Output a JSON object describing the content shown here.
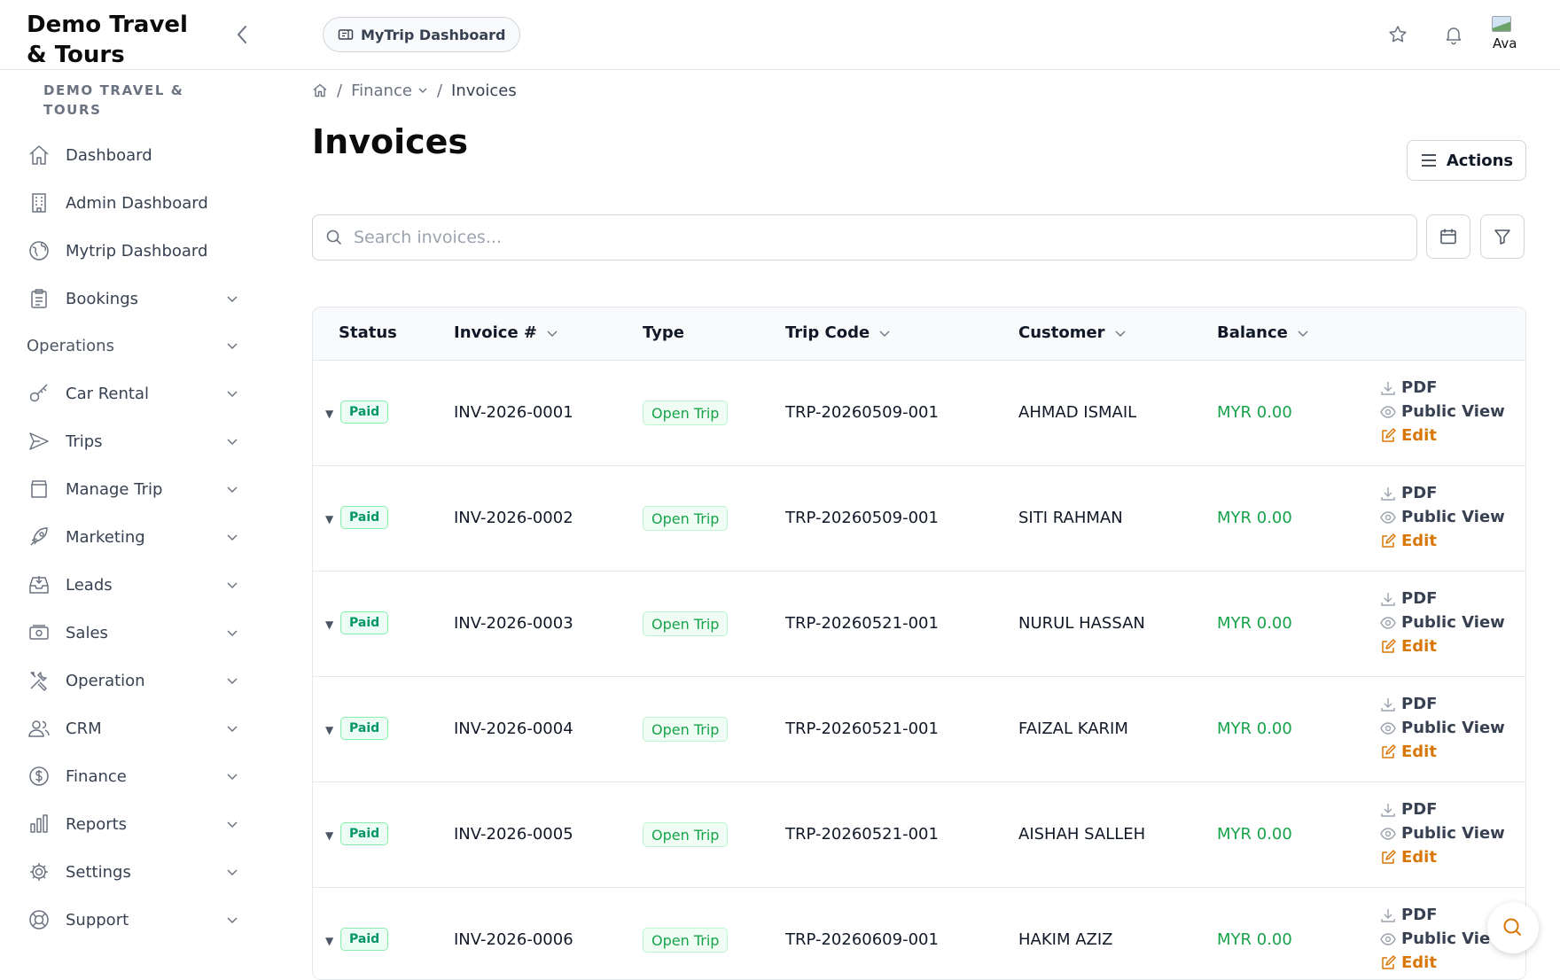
{
  "app": {
    "brand": "Demo Travel & Tours"
  },
  "topbar": {
    "pill_label": "MyTrip Dashboard",
    "avatar_alt": "Ava"
  },
  "sidebar": {
    "section_title": "Demo Travel & Tours",
    "items": [
      {
        "label": "Dashboard",
        "icon": "home-icon",
        "has_chevron": false
      },
      {
        "label": "Admin Dashboard",
        "icon": "building-icon",
        "has_chevron": false
      },
      {
        "label": "Mytrip Dashboard",
        "icon": "globe-icon",
        "has_chevron": false
      },
      {
        "label": "Bookings",
        "icon": "clipboard-icon",
        "has_chevron": true
      }
    ],
    "group_label": "Operations",
    "group_items": [
      {
        "label": "Car Rental",
        "icon": "key-icon"
      },
      {
        "label": "Trips",
        "icon": "send-icon"
      },
      {
        "label": "Manage Trip",
        "icon": "archive-icon"
      },
      {
        "label": "Marketing",
        "icon": "rocket-icon"
      },
      {
        "label": "Leads",
        "icon": "inbox-icon"
      },
      {
        "label": "Sales",
        "icon": "banknote-icon"
      },
      {
        "label": "Operation",
        "icon": "tools-icon"
      },
      {
        "label": "CRM",
        "icon": "users-icon"
      },
      {
        "label": "Finance",
        "icon": "dollar-icon"
      },
      {
        "label": "Reports",
        "icon": "bar-chart-icon"
      },
      {
        "label": "Settings",
        "icon": "gear-icon"
      },
      {
        "label": "Support",
        "icon": "lifebuoy-icon"
      }
    ]
  },
  "breadcrumb": {
    "parent": "Finance",
    "current": "Invoices"
  },
  "page": {
    "title": "Invoices",
    "actions_label": "Actions"
  },
  "search": {
    "placeholder": "Search invoices..."
  },
  "table": {
    "headers": {
      "status": "Status",
      "invoice": "Invoice #",
      "type": "Type",
      "trip_code": "Trip Code",
      "customer": "Customer",
      "balance": "Balance"
    },
    "row_actions": {
      "pdf": "PDF",
      "public_view": "Public View",
      "edit": "Edit"
    },
    "rows": [
      {
        "status": "Paid",
        "invoice": "INV-2026-0001",
        "type": "Open Trip",
        "trip_code": "TRP-20260509-001",
        "customer": "AHMAD ISMAIL",
        "balance": "MYR 0.00"
      },
      {
        "status": "Paid",
        "invoice": "INV-2026-0002",
        "type": "Open Trip",
        "trip_code": "TRP-20260509-001",
        "customer": "SITI RAHMAN",
        "balance": "MYR 0.00"
      },
      {
        "status": "Paid",
        "invoice": "INV-2026-0003",
        "type": "Open Trip",
        "trip_code": "TRP-20260521-001",
        "customer": "NURUL HASSAN",
        "balance": "MYR 0.00"
      },
      {
        "status": "Paid",
        "invoice": "INV-2026-0004",
        "type": "Open Trip",
        "trip_code": "TRP-20260521-001",
        "customer": "FAIZAL KARIM",
        "balance": "MYR 0.00"
      },
      {
        "status": "Paid",
        "invoice": "INV-2026-0005",
        "type": "Open Trip",
        "trip_code": "TRP-20260521-001",
        "customer": "AISHAH SALLEH",
        "balance": "MYR 0.00"
      },
      {
        "status": "Paid",
        "invoice": "INV-2026-0006",
        "type": "Open Trip",
        "trip_code": "TRP-20260609-001",
        "customer": "HAKIM AZIZ",
        "balance": "MYR 0.00"
      }
    ]
  },
  "colors": {
    "paid": "#059669",
    "balance": "#16a34a",
    "edit": "#d97706"
  }
}
